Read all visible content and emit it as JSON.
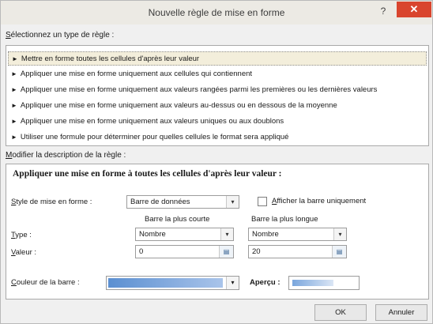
{
  "window": {
    "title": "Nouvelle règle de mise en forme",
    "help_label": "?",
    "close_label": "✕"
  },
  "rule_type": {
    "label_first": "S",
    "label_rest": "électionnez un type de règle :",
    "items": [
      "Mettre en forme toutes les cellules d'après leur valeur",
      "Appliquer une mise en forme uniquement aux cellules qui contiennent",
      "Appliquer une mise en forme uniquement aux valeurs rangées parmi les premières ou les dernières valeurs",
      "Appliquer une mise en forme uniquement aux valeurs au-dessus ou en dessous de la moyenne",
      "Appliquer une mise en forme uniquement aux valeurs uniques ou aux doublons",
      "Utiliser une formule pour déterminer pour quelles cellules le format sera appliqué"
    ],
    "selected_index": 0
  },
  "description": {
    "label_first": "M",
    "label_rest": "odifier la description de la règle :",
    "heading": "Appliquer une mise en forme à toutes les cellules d'après leur valeur :",
    "style_label_first": "S",
    "style_label_rest": "tyle de mise en forme :",
    "style_value": "Barre de données",
    "show_bar_only_first": "A",
    "show_bar_only_rest": "fficher la barre uniquement",
    "shortest_header": "Barre la plus courte",
    "longest_header": "Barre la plus longue",
    "type_label_first": "T",
    "type_label_rest": "ype :",
    "type_min": "Nombre",
    "type_max": "Nombre",
    "value_label_first": "V",
    "value_label_rest": "aleur :",
    "value_min": "0",
    "value_max": "20",
    "bar_color_first": "C",
    "bar_color_rest": "ouleur de la barre :",
    "preview_label": "Aperçu :",
    "bar_color": "#5b8fd1",
    "preview_color": "#7aa6dd"
  },
  "buttons": {
    "ok": "OK",
    "cancel": "Annuler"
  },
  "icons": {
    "dropdown": "▾",
    "picker": "▤",
    "rule_arrow": "►"
  }
}
